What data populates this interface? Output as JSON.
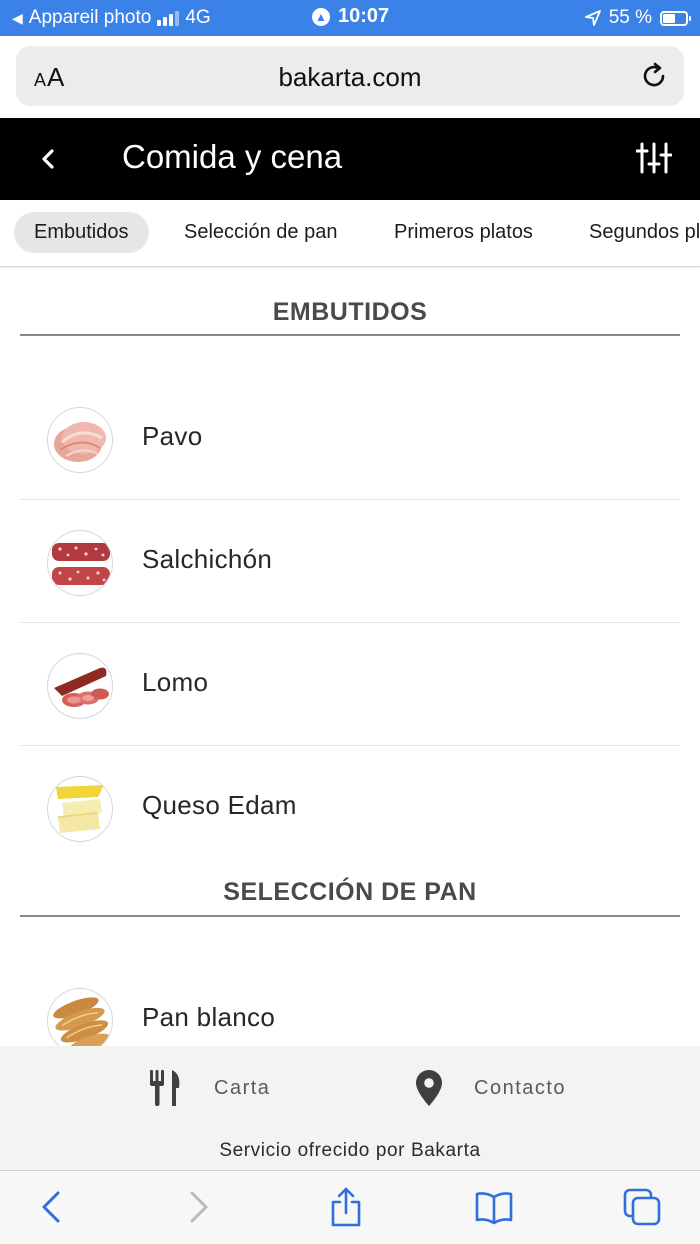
{
  "status_bar": {
    "back_app": "Appareil photo",
    "network": "4G",
    "time": "10:07",
    "battery": "55 %",
    "battery_level": 0.55,
    "signal_bars": 3
  },
  "address_bar": {
    "text_size_label": "AA",
    "url": "bakarta.com"
  },
  "header": {
    "title": "Comida y cena"
  },
  "tabs": [
    {
      "label": "Embutidos",
      "active": true
    },
    {
      "label": "Selección de pan",
      "active": false
    },
    {
      "label": "Primeros platos",
      "active": false
    },
    {
      "label": "Segundos platos",
      "active": false
    }
  ],
  "sections": [
    {
      "title": "EMBUTIDOS",
      "items": [
        {
          "name": "Pavo",
          "image": "turkey-slices"
        },
        {
          "name": "Salchichón",
          "image": "salami-slices"
        },
        {
          "name": "Lomo",
          "image": "cured-loin"
        },
        {
          "name": "Queso Edam",
          "image": "cheese-slices"
        }
      ]
    },
    {
      "title": "SELECCIÓN DE PAN",
      "items": [
        {
          "name": "Pan blanco",
          "image": "bread-rolls"
        }
      ]
    }
  ],
  "footer": {
    "menu_label": "Carta",
    "contact_label": "Contacto",
    "credit": "Servicio ofrecido por Bakarta"
  },
  "colors": {
    "status_bar": "#3b82e8",
    "header_bg": "#000000",
    "safari_icons": "#2f6fde"
  }
}
